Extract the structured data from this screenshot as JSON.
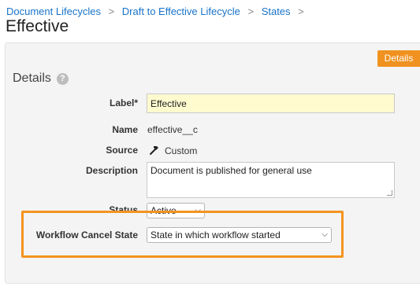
{
  "breadcrumb": {
    "items": [
      "Document Lifecycles",
      "Draft to Effective Lifecycle",
      "States"
    ],
    "separator": ">"
  },
  "page": {
    "title": "Effective"
  },
  "tabs": {
    "details": "Details"
  },
  "section": {
    "title": "Details",
    "help_icon": "?"
  },
  "fields": {
    "label": {
      "label": "Label*",
      "value": "Effective"
    },
    "name": {
      "label": "Name",
      "value": "effective__c"
    },
    "source": {
      "label": "Source",
      "value": "Custom",
      "icon": "hammer-icon"
    },
    "description": {
      "label": "Description",
      "value": "Document is published for general use"
    },
    "status": {
      "label": "Status",
      "value": "Active"
    },
    "workflow_cancel_state": {
      "label": "Workflow Cancel State",
      "value": "State in which workflow started"
    }
  },
  "colors": {
    "link": "#1a73c8",
    "accent": "#f0921f",
    "highlight_border": "#f4941f",
    "required_bg": "#fffbcf"
  }
}
